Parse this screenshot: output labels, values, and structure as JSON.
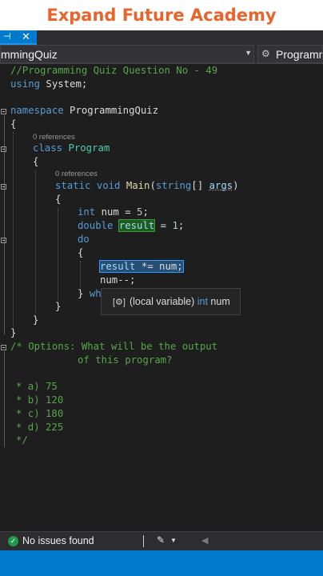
{
  "banner": {
    "title": "Expand Future Academy"
  },
  "tab": {
    "pin_icon": "pin-icon",
    "close_icon": "close-icon"
  },
  "nav": {
    "scope_left": "mmingQuiz",
    "scope_right": "Programm"
  },
  "code": {
    "l1": "//Programming Quiz Question No - 49",
    "l2_kw": "using",
    "l2_rest": " System;",
    "l3_kw": "namespace",
    "l3_rest": " ProgrammingQuiz",
    "brace_open": "{",
    "brace_close": "}",
    "refs": "0 references",
    "l5_kw": "class",
    "l5_ty": "Program",
    "l7_kw": "static void",
    "l7_mt": "Main",
    "l7_p1": "(",
    "l7_kw2": "string",
    "l7_p2": "[] ",
    "l7_vr": "args",
    "l7_p3": ")",
    "l9_kw": "int",
    "l9_rest": " num = ",
    "l9_num": "5",
    "semi": ";",
    "l10_kw": "double",
    "l10_var": "result",
    "l10_rest": " = ",
    "l10_num": "1",
    "l11_kw": "do",
    "l13_var": "result",
    "l13_rest": " *= num;",
    "l14": "num--;",
    "l15_brace": "} ",
    "l15_kw": "wh",
    "opt1": "/* Options: What will be the output",
    "opt2": "of this program?",
    "optA": "* a) 75",
    "optB": "* b) 120",
    "optC": "* c) 180",
    "optD": "* d) 225",
    "optEnd": "*/"
  },
  "tooltip": {
    "icon": "local-variable-icon",
    "pre": "(local variable) ",
    "kw": "int",
    "name": " num"
  },
  "status": {
    "text": "No issues found",
    "ok_icon": "check-circle-icon",
    "brush_icon": "brush-icon"
  },
  "colors": {
    "comment": "#57a64a",
    "keyword": "#569cd6",
    "type": "#4ec9b0",
    "method": "#dcdcaa",
    "number": "#b5cea8",
    "variable": "#9cdcfe",
    "accent": "#007acc",
    "banner": "#e8642a"
  }
}
